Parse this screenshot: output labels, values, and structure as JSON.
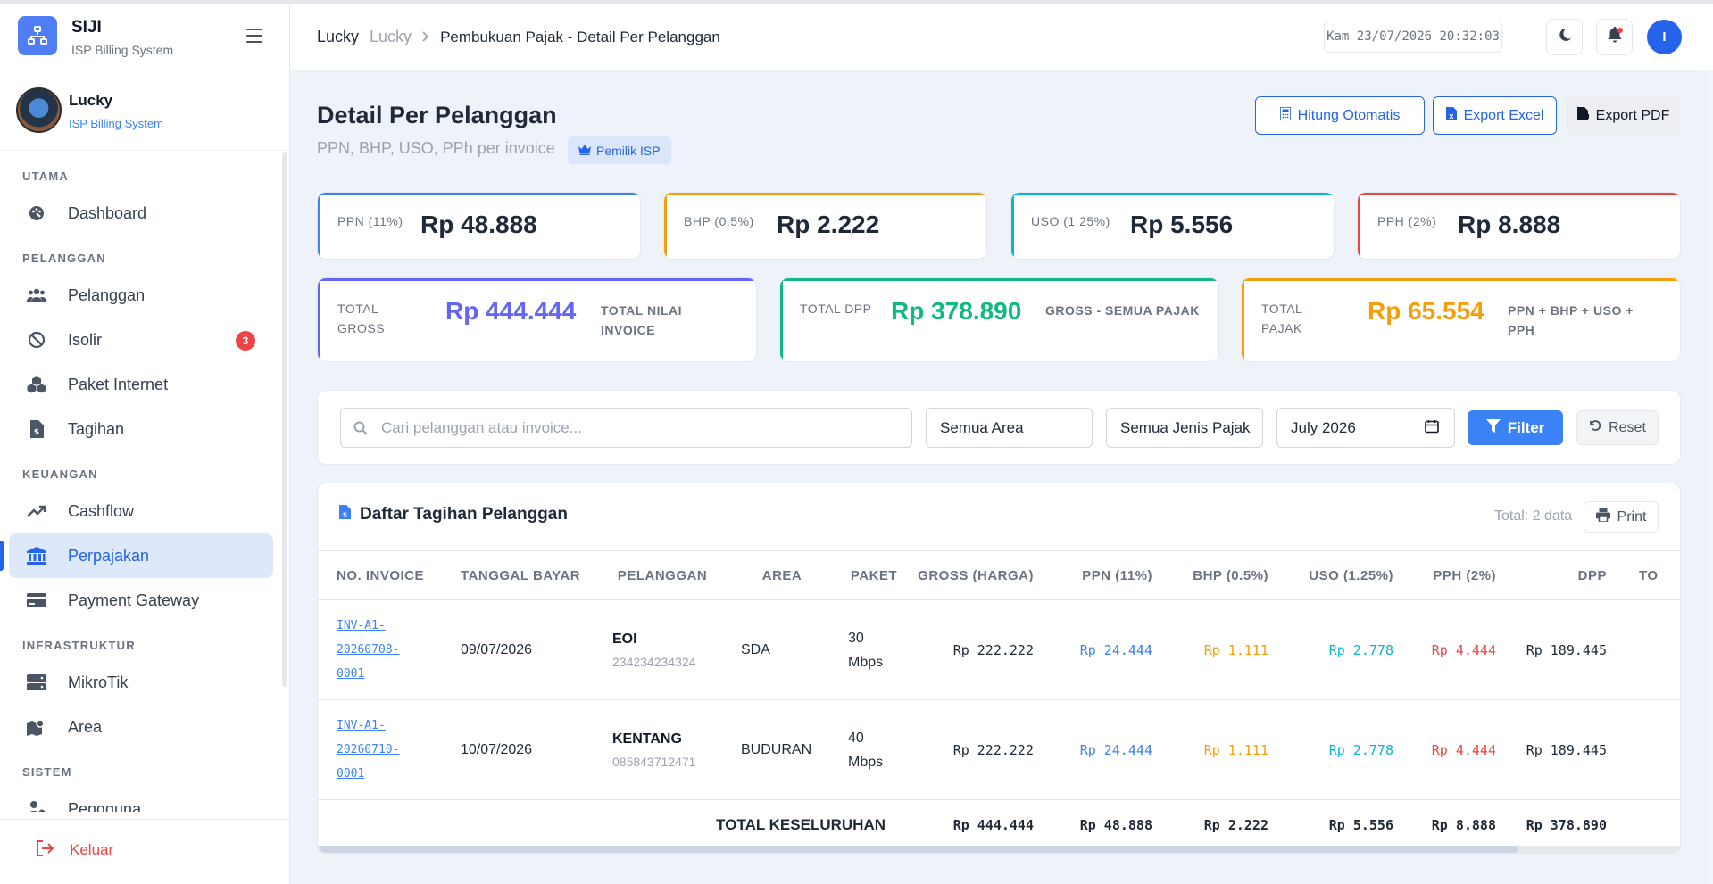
{
  "brand": {
    "name": "SIJI",
    "subtitle": "ISP Billing System"
  },
  "user": {
    "name": "Lucky",
    "role": "ISP Billing System"
  },
  "sidebar": {
    "sections": [
      {
        "label": "UTAMA",
        "items": [
          {
            "label": "Dashboard",
            "icon": "palette-icon"
          }
        ]
      },
      {
        "label": "PELANGGAN",
        "items": [
          {
            "label": "Pelanggan",
            "icon": "users-icon"
          },
          {
            "label": "Isolir",
            "icon": "ban-icon",
            "badge": "3"
          },
          {
            "label": "Paket Internet",
            "icon": "boxes-icon"
          },
          {
            "label": "Tagihan",
            "icon": "invoice-icon"
          }
        ]
      },
      {
        "label": "KEUANGAN",
        "items": [
          {
            "label": "Cashflow",
            "icon": "trend-up-icon"
          },
          {
            "label": "Perpajakan",
            "icon": "bank-icon",
            "active": true
          },
          {
            "label": "Payment Gateway",
            "icon": "credit-card-icon"
          }
        ]
      },
      {
        "label": "INFRASTRUKTUR",
        "items": [
          {
            "label": "MikroTik",
            "icon": "server-icon"
          },
          {
            "label": "Area",
            "icon": "map-icon"
          }
        ]
      },
      {
        "label": "SISTEM",
        "items": [
          {
            "label": "Pengguna",
            "icon": "user-cog-icon"
          }
        ]
      }
    ],
    "logout": "Keluar"
  },
  "header": {
    "breadcrumb": [
      "Lucky",
      "Lucky",
      "Pembukuan Pajak - Detail Per Pelanggan"
    ],
    "clock": "Kam 23/07/2026 20:32:03",
    "profile_initial": "I"
  },
  "page": {
    "title": "Detail Per Pelanggan",
    "subtitle": "PPN, BHP, USO, PPh per invoice",
    "owner_badge": "Pemilik ISP",
    "actions": {
      "auto": "Hitung Otomatis",
      "excel": "Export Excel",
      "pdf": "Export PDF"
    }
  },
  "tax_cards": [
    {
      "label": "PPN (11%)",
      "value": "Rp 48.888",
      "color": "#3b82f6"
    },
    {
      "label": "BHP (0.5%)",
      "value": "Rp 2.222",
      "color": "#f59e0b"
    },
    {
      "label": "USO (1.25%)",
      "value": "Rp 5.556",
      "color": "#06b6d4"
    },
    {
      "label": "PPH (2%)",
      "value": "Rp 8.888",
      "color": "#ef4444"
    }
  ],
  "summary_cards": [
    {
      "label_1": "TOTAL",
      "label_2": "GROSS",
      "value": "Rp 444.444",
      "desc_1": "TOTAL NILAI",
      "desc_2": "INVOICE",
      "color": "#6366f1"
    },
    {
      "label_1": "TOTAL DPP",
      "label_2": "",
      "value": "Rp 378.890",
      "desc_1": "GROSS - SEMUA PAJAK",
      "desc_2": "",
      "color": "#10b981"
    },
    {
      "label_1": "TOTAL",
      "label_2": "PAJAK",
      "value": "Rp 65.554",
      "desc_1": "PPN + BHP + USO +",
      "desc_2": "PPH",
      "color": "#f59e0b"
    }
  ],
  "filters": {
    "search_placeholder": "Cari pelanggan atau invoice...",
    "area": "Semua Area",
    "tax_type": "Semua Jenis Pajak",
    "month": "July 2026",
    "filter_btn": "Filter",
    "reset_btn": "Reset"
  },
  "table": {
    "title": "Daftar Tagihan Pelanggan",
    "total_text": "Total: 2 data",
    "print": "Print",
    "columns": [
      "NO. INVOICE",
      "TANGGAL BAYAR",
      "PELANGGAN",
      "AREA",
      "PAKET",
      "GROSS (HARGA)",
      "PPN (11%)",
      "BHP (0.5%)",
      "USO (1.25%)",
      "PPH (2%)",
      "DPP",
      "TO"
    ],
    "rows": [
      {
        "inv_1": "INV-A1-",
        "inv_2": "20260708-",
        "inv_3": "0001",
        "date": "09/07/2026",
        "name": "EOI",
        "phone": "234234234324",
        "area": "SDA",
        "paket_1": "30",
        "paket_2": "Mbps",
        "gross": "Rp 222.222",
        "ppn": "Rp 24.444",
        "bhp": "Rp 1.111",
        "uso": "Rp 2.778",
        "pph": "Rp 4.444",
        "dpp": "Rp 189.445"
      },
      {
        "inv_1": "INV-A1-",
        "inv_2": "20260710-",
        "inv_3": "0001",
        "date": "10/07/2026",
        "name": "KENTANG",
        "phone": "085843712471",
        "area": "BUDURAN",
        "paket_1": "40",
        "paket_2": "Mbps",
        "gross": "Rp 222.222",
        "ppn": "Rp 24.444",
        "bhp": "Rp 1.111",
        "uso": "Rp 2.778",
        "pph": "Rp 4.444",
        "dpp": "Rp 189.445"
      }
    ],
    "footer": {
      "label": "TOTAL KESELURUHAN",
      "gross": "Rp 444.444",
      "ppn": "Rp 48.888",
      "bhp": "Rp 2.222",
      "uso": "Rp 5.556",
      "pph": "Rp 8.888",
      "dpp": "Rp 378.890"
    }
  }
}
